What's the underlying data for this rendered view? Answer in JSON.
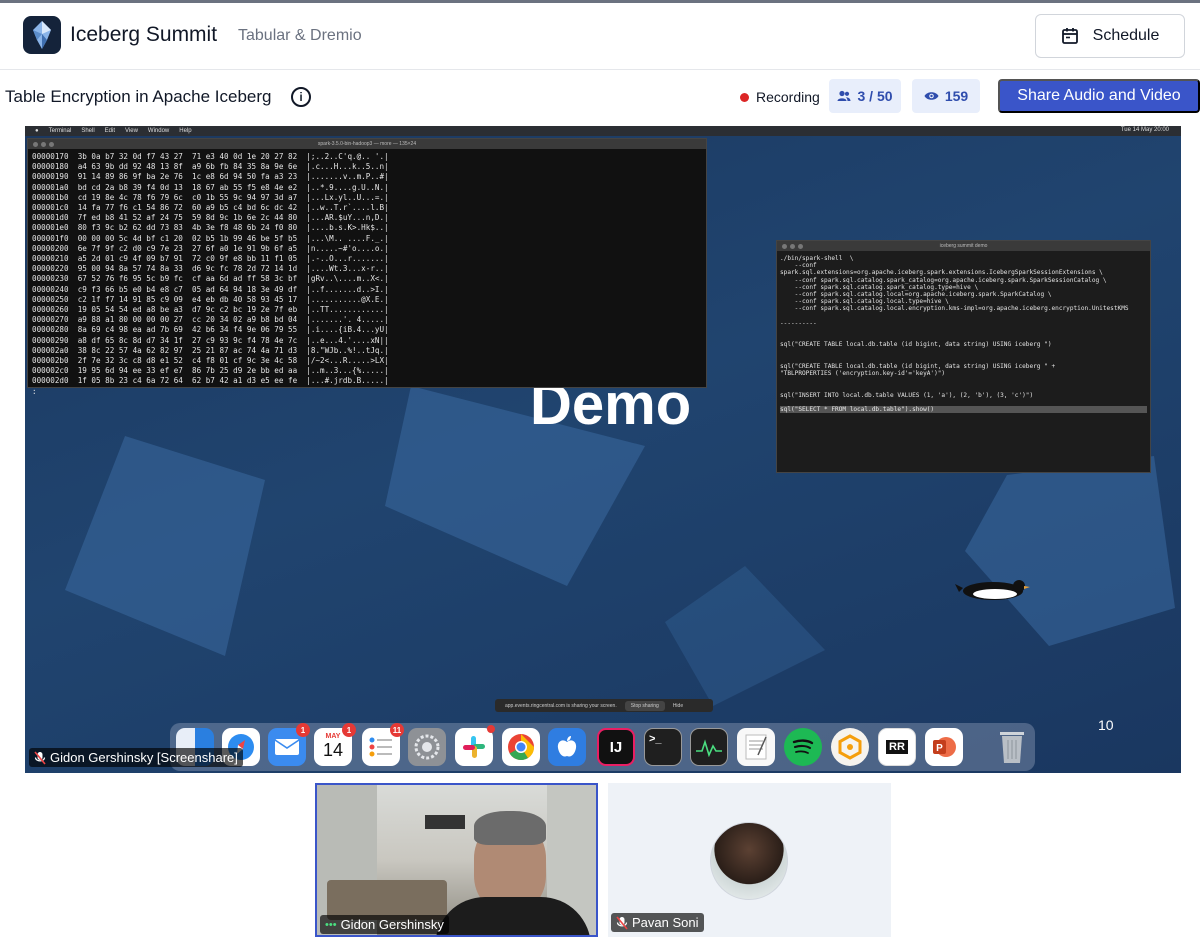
{
  "header": {
    "brand": "Iceberg Summit",
    "org": "Tabular & Dremio",
    "schedule_label": "Schedule"
  },
  "toolbar": {
    "session_title": "Table Encryption in Apache Iceberg",
    "info_icon": "i",
    "recording_label": "Recording",
    "attendees": "3 / 50",
    "views": "159",
    "share_label": "Share Audio and Video"
  },
  "screen": {
    "mac_menu": [
      "Terminal",
      "Shell",
      "Edit",
      "View",
      "Window",
      "Help"
    ],
    "clock": "Tue 14 May 20:00",
    "hex_title": "spark-3.5.0-bin-hadoop3 — more — 135×24",
    "hex_dump": "00000170  3b 0a b7 32 0d f7 43 27  71 e3 40 0d 1e 20 27 82  |;..2..C'q.@.. '.|\n00000180  a4 63 9b dd 92 48 13 8f  a9 6b fb 84 35 8a 9e 6e  |.c...H...k..5..n|\n00000190  91 14 89 86 9f ba 2e 76  1c e8 6d 94 50 fa a3 23  |.......v..m.P..#|\n000001a0  bd cd 2a b8 39 f4 0d 13  18 67 ab 55 f5 e8 4e e2  |..*.9....g.U..N.|\n000001b0  cd 19 8e 4c 78 f6 79 6c  c0 1b 55 9c 94 97 3d a7  |...Lx.yl..U...=.|\n000001c0  14 fa 77 f6 c1 54 86 72  60 a9 b5 c4 bd 6c dc 42  |..w..T.r`....l.B|\n000001d0  7f ed b8 41 52 af 24 75  59 8d 9c 1b 6e 2c 44 80  |...AR.$uY...n,D.|\n000001e0  80 f3 9c b2 62 dd 73 83  4b 3e f8 48 6b 24 f0 80  |....b.s.K>.Hk$..|\n000001f0  00 00 00 5c 4d bf c1 20  02 b5 1b 99 46 be 5f b5  |...\\M.. ....F._.|\n00000200  6e 7f 9f c2 d0 c9 7e 23  27 6f a0 1e 91 9b 6f a5  |n.....~#'o....o.|\n00000210  a5 2d 01 c9 4f 09 b7 91  72 c0 9f e8 bb 11 f1 05  |.-..O...r.......|\n00000220  95 00 94 8a 57 74 8a 33  d6 9c fc 78 2d 72 14 1d  |....Wt.3...x-r..|\n00000230  67 52 76 f6 95 5c b9 fc  cf aa 6d ad ff 58 3c bf  |gRv..\\....m..X<.|\n00000240  c9 f3 66 b5 e0 b4 e8 c7  05 ad 64 94 18 3e 49 df  |..f.......d..>I.|\n00000250  c2 1f f7 14 91 85 c9 09  e4 eb db 40 58 93 45 17  |...........@X.E.|\n00000260  19 05 54 54 ed a8 be a3  d7 9c c2 bc 19 2e 7f eb  |..TT............|\n00000270  a9 88 a1 80 00 00 00 27  cc 20 34 02 a9 b8 bd 04  |.......'. 4.....|\n00000280  8a 69 c4 98 ea ad 7b 69  42 b6 34 f4 9e 06 79 55  |.i....{iB.4...yU|\n00000290  a8 df 65 8c 8d d7 34 1f  27 c9 93 9c f4 78 4e 7c  |..e...4.'....xN||\n000002a0  38 8c 22 57 4a 62 82 97  25 21 87 ac 74 4a 71 d3  |8.\"WJb..%!..tJq.|\n000002b0  2f 7e 32 3c c8 d8 e1 52  c4 f8 01 cf 9c 3e 4c 58  |/~2<...R.....>LX|\n000002c0  19 95 6d 94 ee 33 ef e7  86 7b 25 d9 2e bb ed aa  |..m..3...{%.....|\n000002d0  1f 05 8b 23 c4 6a 72 64  62 b7 42 a1 d3 e5 ee fe  |...#.jrdb.B.....|\n:",
    "shell_title": "iceberg summit demo",
    "shell_code": "./bin/spark-shell  \\\n    --conf\nspark.sql.extensions=org.apache.iceberg.spark.extensions.IcebergSparkSessionExtensions \\\n    --conf spark.sql.catalog.spark_catalog=org.apache.iceberg.spark.SparkSessionCatalog \\\n    --conf spark.sql.catalog.spark_catalog.type=hive \\\n    --conf spark.sql.catalog.local=org.apache.iceberg.spark.SparkCatalog \\\n    --conf spark.sql.catalog.local.type=hive \\\n    --conf spark.sql.catalog.local.encryption.kms-impl=org.apache.iceberg.encryption.UnitestKMS\n\n----------\n\n\nsql(\"CREATE TABLE local.db.table (id bigint, data string) USING iceberg \")\n\n\nsql(\"CREATE TABLE local.db.table (id bigint, data string) USING iceberg \" +\n\"TBLPROPERTIES ('encryption.key-id'='keyA')\")\n\n\nsql(\"INSERT INTO local.db.table VALUES (1, 'a'), (2, 'b'), (3, 'c')\")\n\n",
    "shell_highlight": "sql(\"SELECT * FROM local.db.table\").show()",
    "slide_text": "Demo",
    "share_banner": "app.events.ringcentral.com is sharing your screen.",
    "stop_sharing": "Stop sharing",
    "hide": "Hide",
    "page_num": "10",
    "dock": {
      "mail_badge": "1",
      "cal_badge": "1",
      "cal_month": "MAY",
      "cal_day": "14",
      "reminders_badge": "11",
      "intellij": "IJ",
      "terminal": ">_",
      "rr": "RR"
    },
    "presenter_tag": "Gidon Gershinsky [Screenshare]"
  },
  "participants": [
    {
      "name": "Gidon Gershinsky"
    },
    {
      "name": "Pavan Soni"
    }
  ]
}
